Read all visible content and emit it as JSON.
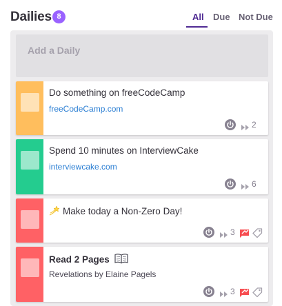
{
  "header": {
    "title": "Dailies",
    "count": "8",
    "tabs": [
      {
        "label": "All",
        "active": true
      },
      {
        "label": "Due",
        "active": false
      },
      {
        "label": "Not Due",
        "active": false
      }
    ]
  },
  "add_task": {
    "label": "Add a Daily"
  },
  "colors": {
    "accent": "#4f2a93",
    "badge": "#9a62ff",
    "orange": "#ffbe5d",
    "green": "#24cc8f",
    "red": "#ff6165",
    "link": "#2a7ed3"
  },
  "tasks": [
    {
      "title": "Do something on freeCodeCamp",
      "notes": "freeCodeCamp.com",
      "notes_is_link": true,
      "streak": "2",
      "color": "orange",
      "show_challenge": false,
      "show_tags": false
    },
    {
      "title": "Spend 10 minutes on InterviewCake",
      "notes": "interviewcake.com",
      "notes_is_link": true,
      "streak": "6",
      "color": "green",
      "show_challenge": false,
      "show_tags": false
    },
    {
      "title": "Make today a Non-Zero Day!",
      "title_icon": "shooting-star-icon",
      "notes": "",
      "streak": "3",
      "color": "red",
      "show_challenge": true,
      "show_tags": true
    },
    {
      "title": "Read 2 Pages",
      "title_icon": "open-book-icon",
      "notes": "Revelations by Elaine Pagels",
      "notes_is_link": false,
      "streak": "3",
      "color": "red",
      "show_challenge": true,
      "show_tags": true
    }
  ]
}
